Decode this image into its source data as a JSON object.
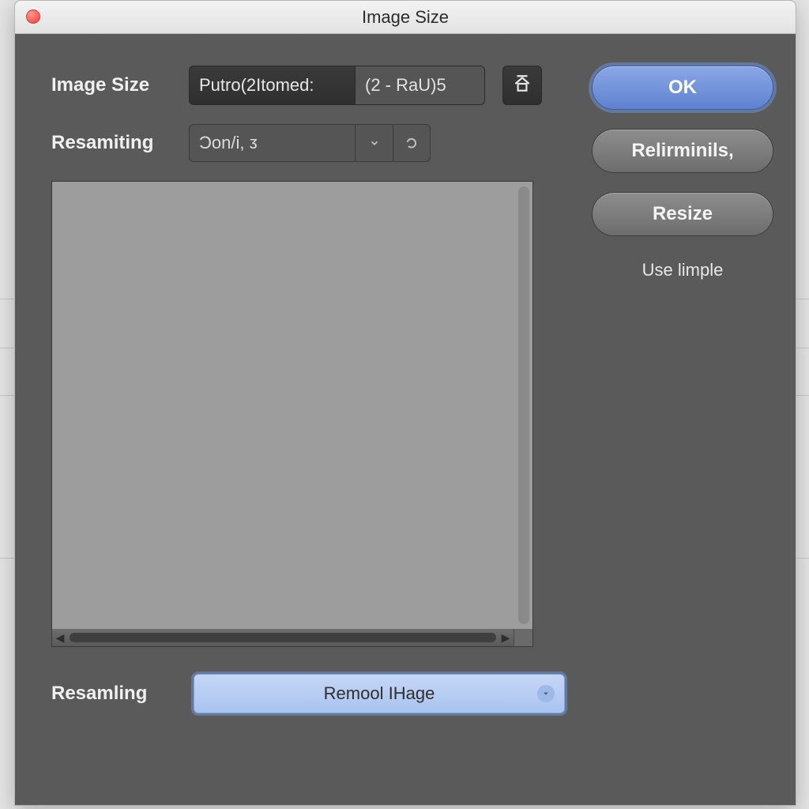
{
  "window": {
    "title": "Image Size"
  },
  "fields": {
    "image_size": {
      "label": "Image Size",
      "value": "Putro(2Itomed:",
      "readout": "(2 - RaU)5"
    },
    "resampling_top": {
      "label": "Resamiting",
      "value": "Ɔon/i, ᴣ"
    },
    "resampling_bottom": {
      "label": "Resamling",
      "value": "Remool IHage"
    }
  },
  "buttons": {
    "ok": "OK",
    "relirminils": "Relirminils,",
    "resize": "Resize",
    "use_limple": "Use limple"
  }
}
